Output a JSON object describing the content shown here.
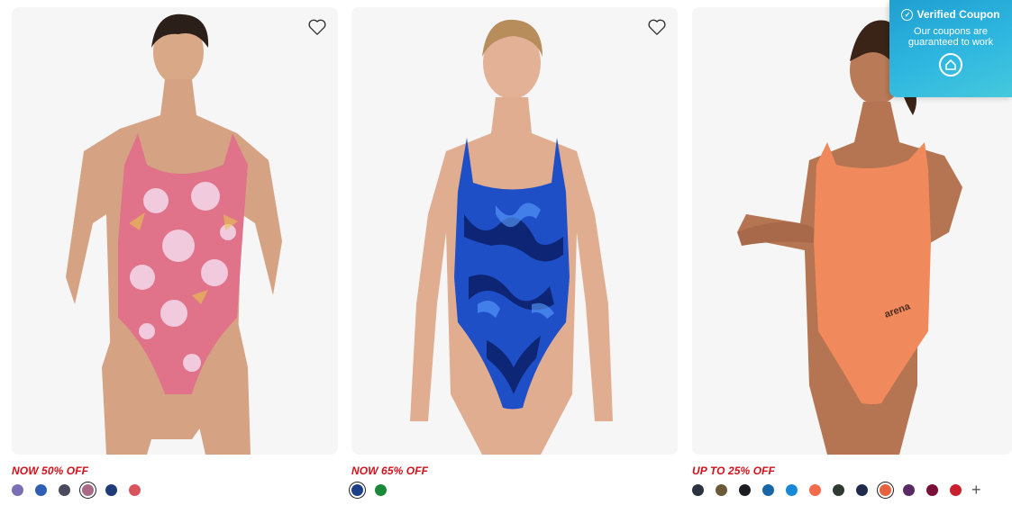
{
  "products": [
    {
      "sale_text": "NOW 50% OFF",
      "suit_color": "#e0738a",
      "swatches": [
        "#7a6fb6",
        "#2f5fb5",
        "#4a4a5c",
        "#a86a86",
        "#1f3b78",
        "#d9535c"
      ],
      "selected_swatch": 3,
      "has_more": false
    },
    {
      "sale_text": "NOW 65% OFF",
      "suit_color": "#1f4fc7",
      "swatches": [
        "#1d3f8a",
        "#1a8a3a"
      ],
      "selected_swatch": 0,
      "has_more": false
    },
    {
      "sale_text": "UP TO 25% OFF",
      "suit_color": "#f08a5c",
      "swatches": [
        "#2c3240",
        "#6b5a3a",
        "#1b1d22",
        "#1767a6",
        "#1688d8",
        "#f26b4a",
        "#2f3a30",
        "#1f2a4c",
        "#e7633f",
        "#5a2a66",
        "#7a0f3a",
        "#c8202c"
      ],
      "selected_swatch": 8,
      "has_more": true,
      "more_label": "+"
    }
  ],
  "coupon": {
    "title": "Verified Coupon",
    "subtitle": "Our coupons are guaranteed to work"
  }
}
